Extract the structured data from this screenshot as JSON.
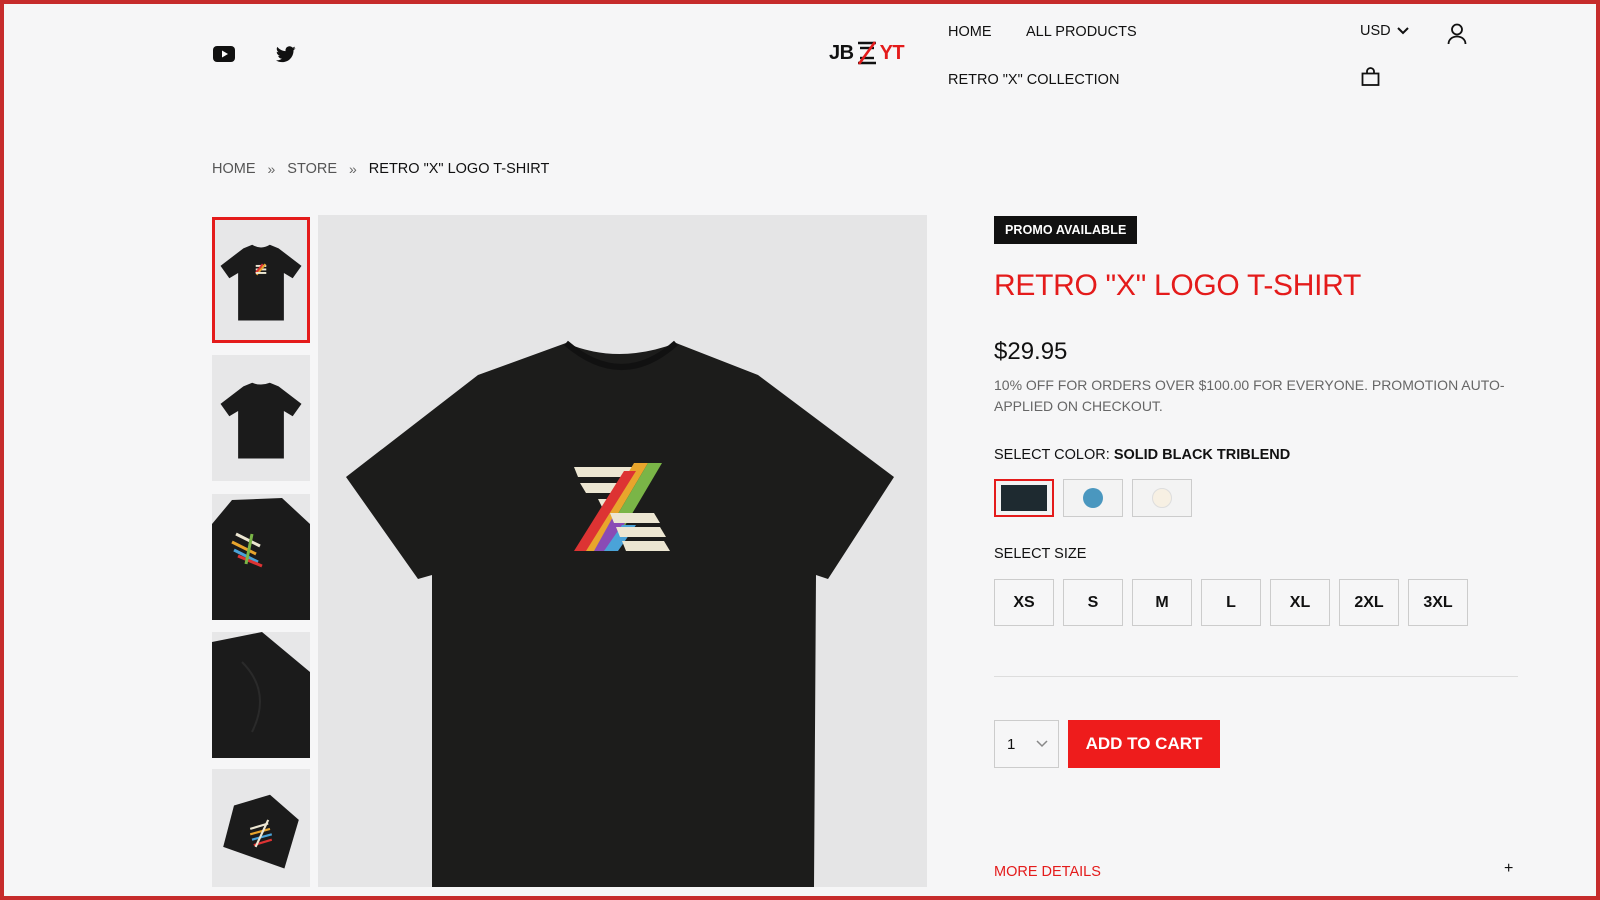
{
  "brand": {
    "logo_left": "JB",
    "logo_right": "YT"
  },
  "social": {
    "youtube": "youtube-icon",
    "twitter": "twitter-icon"
  },
  "nav": {
    "items": [
      {
        "label": "HOME"
      },
      {
        "label": "ALL PRODUCTS"
      },
      {
        "label": "RETRO \"X\" COLLECTION"
      }
    ],
    "currency": "USD",
    "icons": {
      "account": "user-icon",
      "cart": "shopping-bag-icon"
    }
  },
  "breadcrumb": {
    "items": [
      "HOME",
      "STORE"
    ],
    "separator": "»",
    "current": "RETRO \"X\" LOGO T-SHIRT"
  },
  "product": {
    "badge": "PROMO AVAILABLE",
    "title": "RETRO \"X\" LOGO T-SHIRT",
    "price": "$29.95",
    "promo_text": "10% OFF FOR ORDERS OVER $100.00 FOR EVERYONE. PROMOTION AUTO-APPLIED ON CHECKOUT.",
    "color_label": "SELECT COLOR:",
    "selected_color": "SOLID BLACK TRIBLEND",
    "colors": [
      {
        "name": "solid-black",
        "hex": "#1e2a30"
      },
      {
        "name": "blue",
        "hex": "#4a97bf"
      },
      {
        "name": "cream",
        "hex": "#f7f0e3"
      }
    ],
    "size_label": "SELECT SIZE",
    "sizes": [
      "XS",
      "S",
      "M",
      "L",
      "XL",
      "2XL",
      "3XL"
    ],
    "quantity": "1",
    "add_to_cart": "ADD TO CART",
    "more_details": "MORE DETAILS",
    "more_details_toggle": "+"
  },
  "theme": {
    "accent": "#e41b1b",
    "border": "#c62b2b",
    "background": "#f6f6f7"
  }
}
